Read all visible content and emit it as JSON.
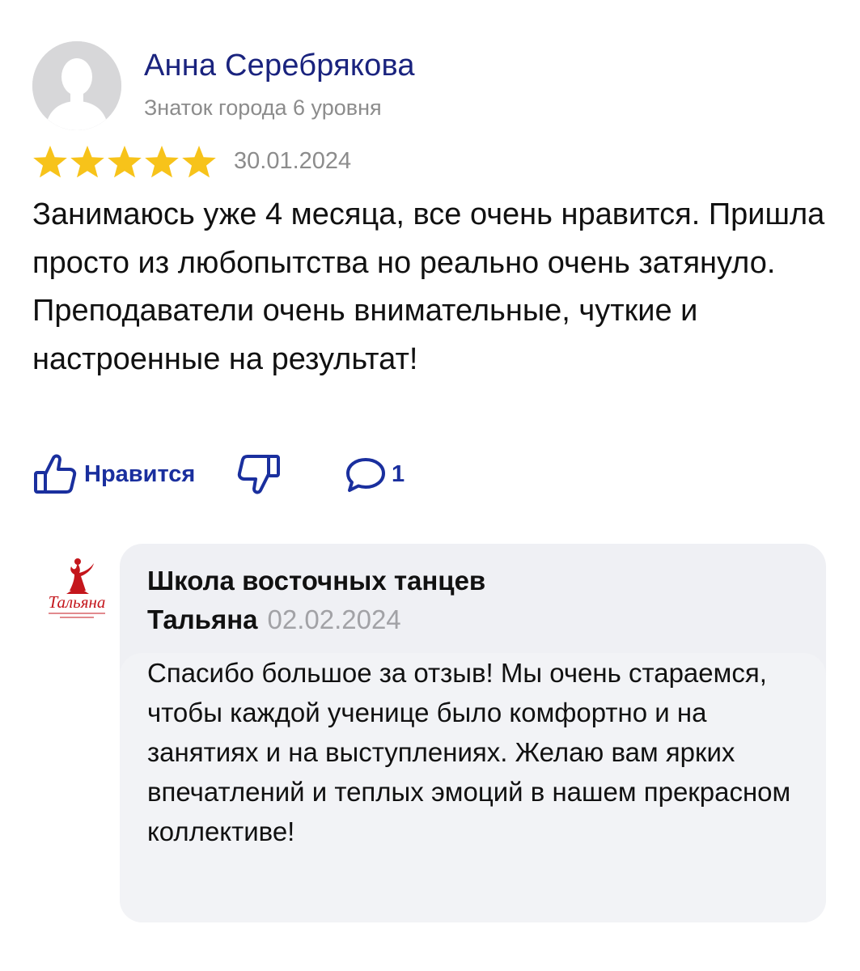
{
  "review": {
    "author_name": "Анна Серебрякова",
    "author_level": "Знаток города 6 уровня",
    "rating": 5,
    "rating_max": 5,
    "date": "30.01.2024",
    "text": "Занимаюсь уже 4 месяца, все очень нравится. Пришла просто из любопытства но реально очень затянуло. Преподаватели очень внимательные, чуткие и настроенные на результат!",
    "actions": {
      "like_label": "Нравится",
      "comment_count": "1"
    }
  },
  "reply": {
    "logo_text": "Тальяна",
    "org_name_line1": "Школа восточных танцев",
    "org_name_line2": "Тальяна",
    "date": "02.02.2024",
    "text": "Спасибо большое за отзыв! Мы очень стараемся, чтобы каждой ученице было комфортно и на занятиях и на выступлениях. Желаю вам ярких впечатлений и  теплых эмоций в нашем прекрасном коллективе!"
  },
  "colors": {
    "name_blue": "#1a237e",
    "action_blue": "#1a2f9e",
    "star_yellow": "#f7c31a",
    "muted_gray": "#8c8c8c",
    "card_bg": "#eff0f4",
    "logo_red": "#c4161c"
  },
  "icons": {
    "avatar": "default-user-silhouette",
    "like": "thumbs-up-outline-icon",
    "dislike": "thumbs-down-outline-icon",
    "comment": "speech-bubble-icon",
    "star": "filled-star-icon"
  }
}
